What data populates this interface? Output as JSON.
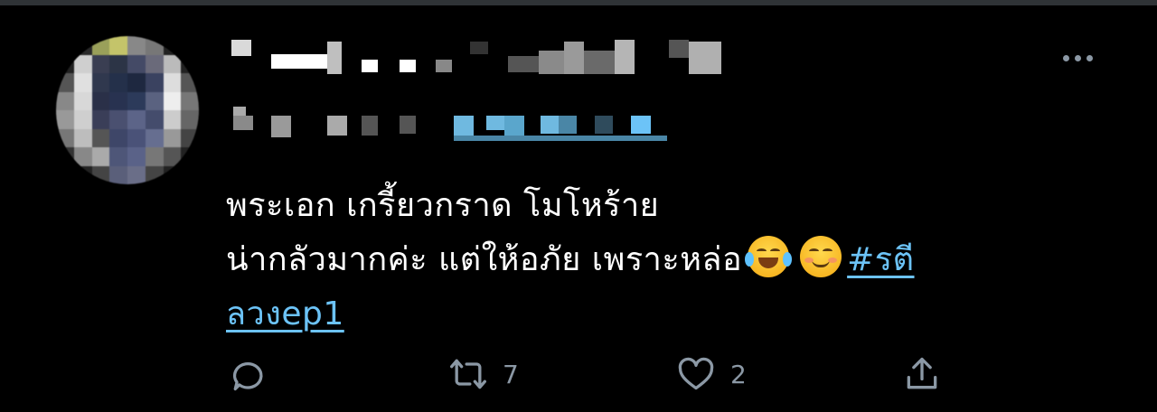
{
  "tweet": {
    "text_lines": [
      "พระเอก เกรี้ยวกราด  โมโหร้าย",
      "น่ากลัวมากค่ะ แต่ให้อภัย เพราะหล่อ"
    ],
    "hashtag_part1": "#รตี",
    "hashtag_part2": "ลวงep1",
    "emojis": [
      "face-with-tears-of-joy",
      "smiling-face"
    ]
  },
  "actions": {
    "reply": {
      "icon": "reply-icon",
      "count": ""
    },
    "retweet": {
      "icon": "retweet-icon",
      "count": "7"
    },
    "like": {
      "icon": "heart-icon",
      "count": "2"
    },
    "share": {
      "icon": "share-icon",
      "count": ""
    }
  },
  "colors": {
    "background": "#000000",
    "text": "#ffffff",
    "link": "#6cc3f7",
    "muted": "#8b98a5"
  }
}
